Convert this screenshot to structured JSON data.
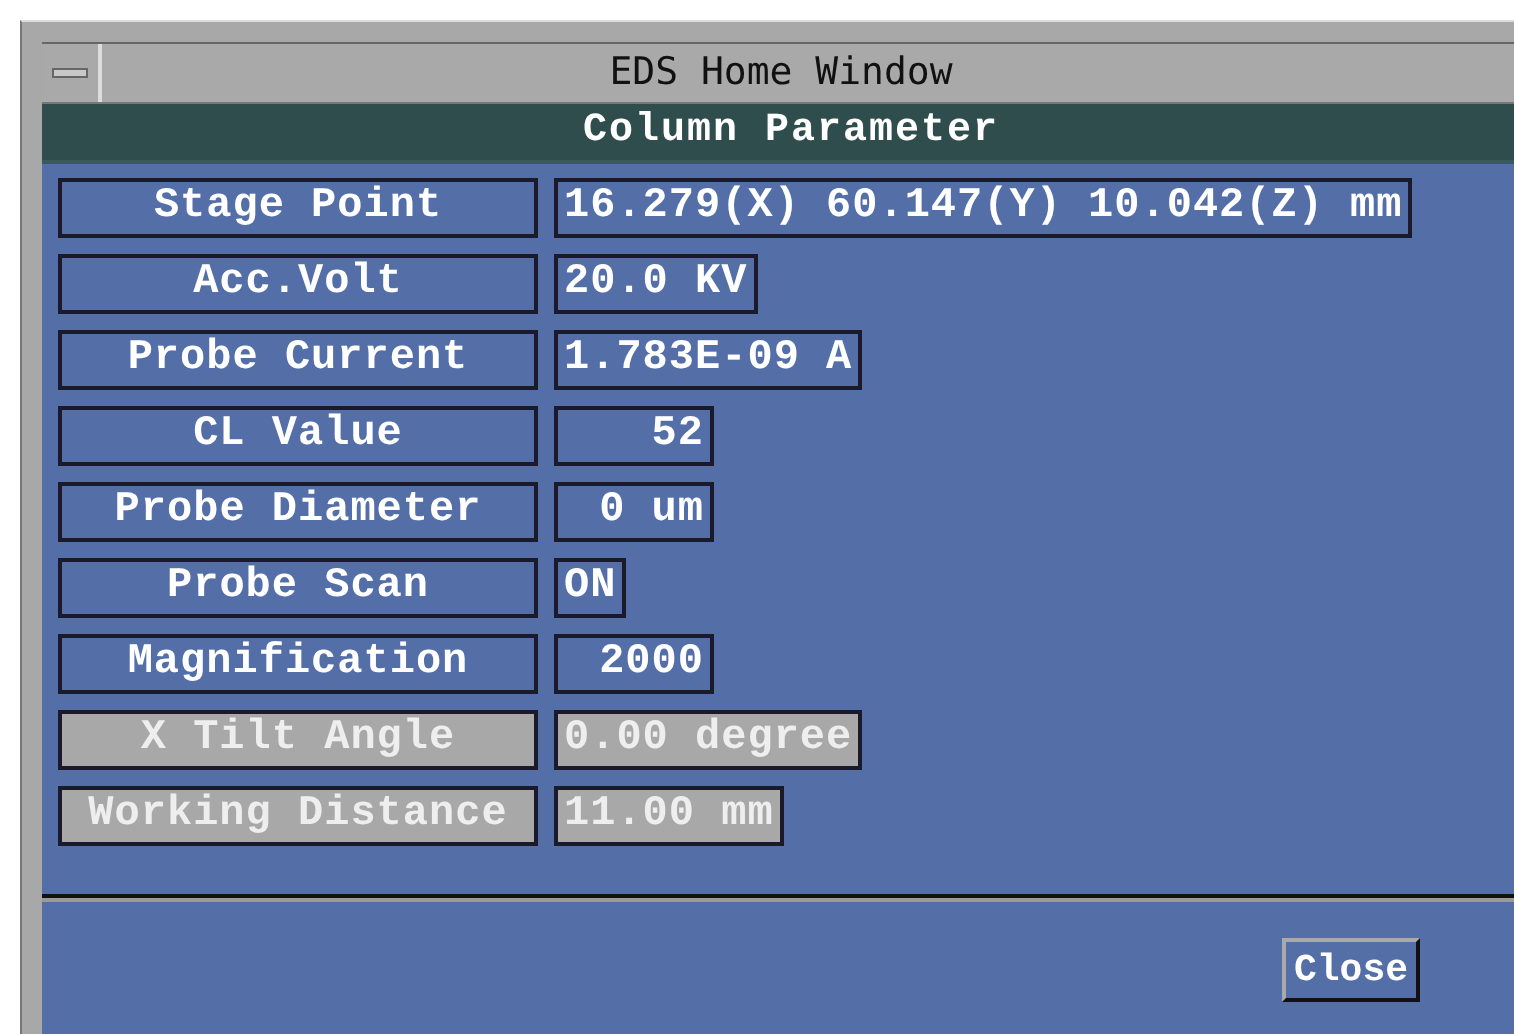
{
  "window": {
    "title": "EDS Home Window"
  },
  "header": "Column Parameter",
  "parameters": [
    {
      "label": "Stage Point",
      "value": "16.279(X) 60.147(Y) 10.042(Z) mm",
      "kind": "text",
      "disabled": false
    },
    {
      "label": "Acc.Volt",
      "value": "20.0 KV",
      "kind": "text",
      "disabled": false
    },
    {
      "label": "Probe Current",
      "value": "1.783E-09 A",
      "kind": "text",
      "disabled": false
    },
    {
      "label": "CL Value",
      "value": "52",
      "kind": "number",
      "disabled": false
    },
    {
      "label": "Probe Diameter",
      "value": "0 um",
      "kind": "number",
      "disabled": false
    },
    {
      "label": "Probe Scan",
      "value": "ON",
      "kind": "text",
      "disabled": false
    },
    {
      "label": "Magnification",
      "value": "2000",
      "kind": "number",
      "disabled": false
    },
    {
      "label": "X Tilt Angle",
      "value": "0.00 degree",
      "kind": "number",
      "disabled": true
    },
    {
      "label": "Working Distance",
      "value": "11.00 mm",
      "kind": "text",
      "disabled": true
    }
  ],
  "buttons": [
    "Close"
  ]
}
